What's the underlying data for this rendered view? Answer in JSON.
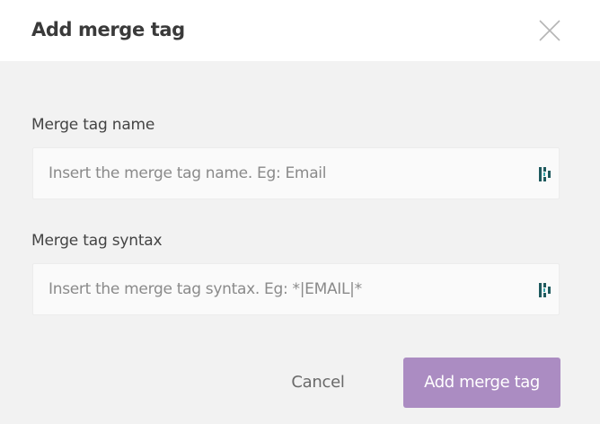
{
  "dialog": {
    "title": "Add merge tag",
    "close_icon": "close-icon"
  },
  "fields": {
    "name": {
      "label": "Merge tag name",
      "value": "",
      "placeholder": "Insert the merge tag name. Eg: Email",
      "icon": "merge-field-icon"
    },
    "syntax": {
      "label": "Merge tag syntax",
      "value": "",
      "placeholder": "Insert the merge tag syntax. Eg: *|EMAIL|*",
      "icon": "merge-field-icon"
    }
  },
  "actions": {
    "cancel_label": "Cancel",
    "submit_label": "Add merge tag"
  },
  "colors": {
    "header_bg": "#ffffff",
    "body_bg": "#f2f2f2",
    "field_bg": "#fafafa",
    "primary_button": "#ab8cc2",
    "field_icon": "#1f5a5e",
    "text": "#3a3a3a"
  }
}
